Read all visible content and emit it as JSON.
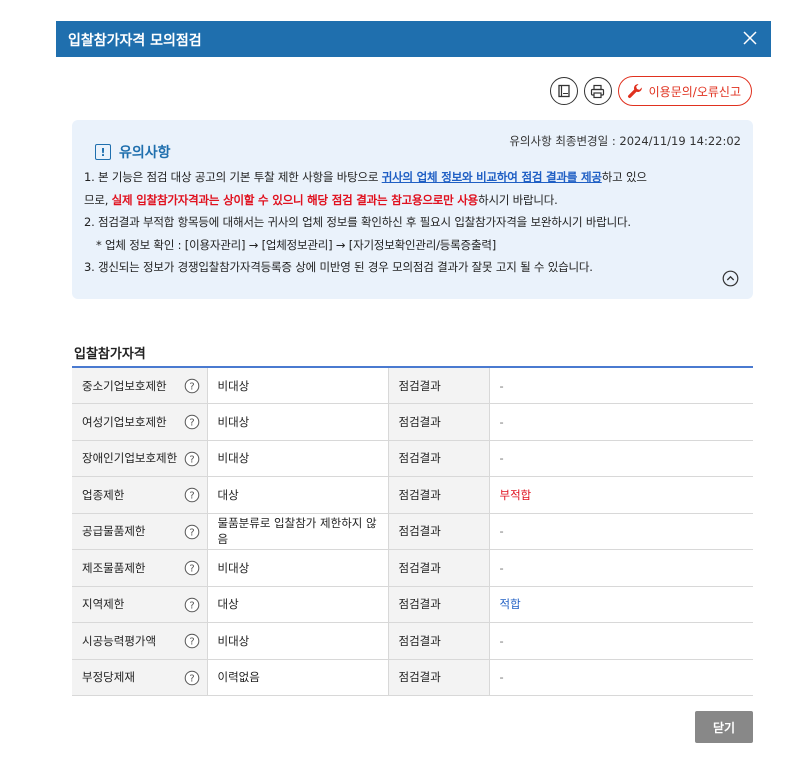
{
  "dialog": {
    "title": "입찰참가자격 모의점검",
    "close_icon": "close-icon"
  },
  "toolbar": {
    "manual_icon": "book-icon",
    "print_icon": "printer-icon",
    "report_label": "이용문의/오류신고",
    "report_icon": "wrench-icon"
  },
  "notice": {
    "heading": "유의사항",
    "updated_label": "유의사항 최종변경일 : 2024/11/19 14:22:02",
    "line1_pre": "1. 본 기능은 점검 대상 공고의 기본 투찰 제한 사항을 바탕으로 ",
    "line1_highlight": "귀사의 업체 정보와 비교하여 점검 결과를 제공",
    "line1_post": "하고 있으",
    "line2_pre": "므로, ",
    "line2_highlight": "실제 입찰참가자격과는 상이할 수 있으니 해당 점검 결과는 참고용으로만 사용",
    "line2_post": "하시기 바랍니다.",
    "line3": "2. 점검결과 부적합 항목등에 대해서는 귀사의 업체 정보를 확인하신 후 필요시 입찰참가자격을 보완하시기 바랍니다.",
    "line4": "* 업체 정보 확인 : [이용자관리] → [업체정보관리] → [자기정보확인관리/등록증출력]",
    "line5": "3. 갱신되는 정보가 경쟁입찰참가자격등록증 상에 미반영 된 경우 모의점검 결과가 잘못 고지 될 수 있습니다."
  },
  "section": {
    "title": "입찰참가자격"
  },
  "table": {
    "result_label": "점검결과",
    "rows": [
      {
        "label": "중소기업보호제한",
        "value": "비대상",
        "result": "-"
      },
      {
        "label": "여성기업보호제한",
        "value": "비대상",
        "result": "-"
      },
      {
        "label": "장애인기업보호제한",
        "value": "비대상",
        "result": "-"
      },
      {
        "label": "업종제한",
        "value": "대상",
        "result": "부적합"
      },
      {
        "label": "공급물품제한",
        "value": "물품분류로 입찰참가 제한하지 않음",
        "result": "-"
      },
      {
        "label": "제조물품제한",
        "value": "비대상",
        "result": "-"
      },
      {
        "label": "지역제한",
        "value": "대상",
        "result": "적합"
      },
      {
        "label": "시공능력평가액",
        "value": "비대상",
        "result": "-"
      },
      {
        "label": "부정당제재",
        "value": "이력없음",
        "result": "-"
      }
    ]
  },
  "footer": {
    "close_label": "닫기"
  },
  "colors": {
    "header": "#1f6fae",
    "notice_bg": "#eaf2fb",
    "accent_red": "#e0111f",
    "accent_blue": "#1f5fc4"
  }
}
